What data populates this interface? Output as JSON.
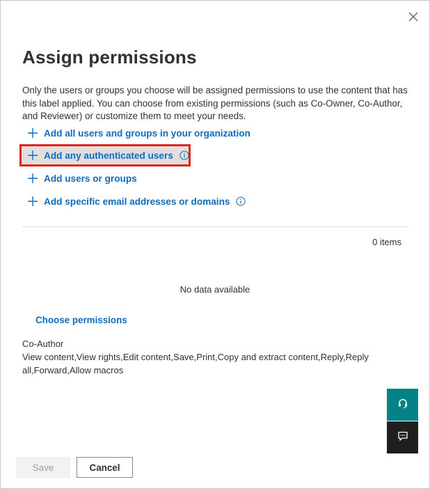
{
  "dialog": {
    "title": "Assign permissions",
    "description": "Only the users or groups you choose will be assigned permissions to use the content that has this label applied. You can choose from existing permissions (such as Co-Owner, Co-Author, and Reviewer) or customize them to meet your needs."
  },
  "actions": [
    {
      "label": "Add all users and groups in your organization",
      "icon": "plus-icon"
    },
    {
      "label": "Add any authenticated users",
      "icon": "plus-icon",
      "info_icon": "info-icon",
      "highlighted": true
    },
    {
      "label": "Add users or groups",
      "icon": "plus-icon"
    },
    {
      "label": "Add specific email addresses or domains",
      "icon": "plus-icon",
      "info_icon": "info-icon"
    }
  ],
  "list": {
    "count_label": "0 items",
    "empty_text": "No data available"
  },
  "permissions": {
    "choose_label": "Choose permissions",
    "selected_name": "Co-Author",
    "selected_rights": "View content,View rights,Edit content,Save,Print,Copy and extract content,Reply,Reply all,Forward,Allow macros"
  },
  "footer": {
    "save_label": "Save",
    "cancel_label": "Cancel"
  },
  "side_buttons": [
    {
      "icon": "headset-icon"
    },
    {
      "icon": "feedback-icon"
    }
  ],
  "colors": {
    "link": "#0f6cbd",
    "highlight_border": "#e0251b",
    "teal_button": "#038387",
    "dark_button": "#201f1e"
  }
}
